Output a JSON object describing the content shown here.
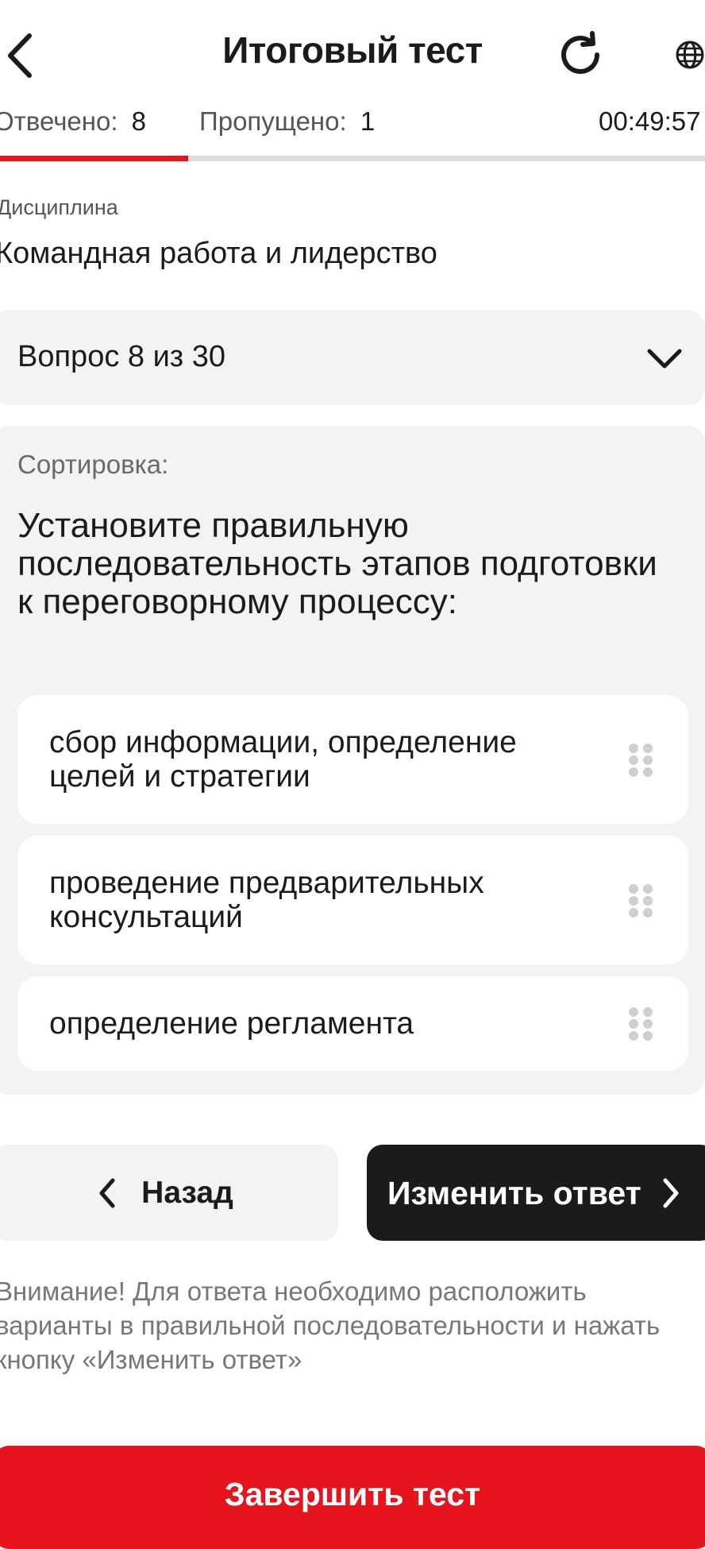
{
  "header": {
    "title": "Итоговый тест",
    "back_icon": "chevron-left-icon",
    "refresh_icon": "refresh-icon",
    "language_icon": "globe-icon"
  },
  "stats": {
    "answered_label": "Отвечено:",
    "answered_value": "8",
    "skipped_label": "Пропущено:",
    "skipped_value": "1",
    "timer": "00:49:57"
  },
  "progress": {
    "fraction": 0.267
  },
  "discipline": {
    "label": "Дисциплина",
    "value": "Командная работа и лидерство"
  },
  "question_selector": {
    "text": "Вопрос 8 из 30",
    "icon": "chevron-down-icon"
  },
  "question": {
    "type_label": "Сортировка:",
    "text": "Установите правильную последовательность этапов подготовки к переговорному процессу:",
    "options": [
      {
        "label": "сбор информации, определение целей и стратегии"
      },
      {
        "label": "проведение предварительных консультаций"
      },
      {
        "label": "определение регламента"
      }
    ]
  },
  "buttons": {
    "back_label": "Назад",
    "change_label": "Изменить ответ",
    "finish_label": "Завершить тест"
  },
  "notice": "Внимание! Для ответа необходимо расположить варианты в правильной последовательности и нажать кнопку «Изменить ответ»",
  "colors": {
    "accent": "#e3161d",
    "dark_button": "#1b1b1b",
    "panel_bg": "#f3f3f3"
  }
}
